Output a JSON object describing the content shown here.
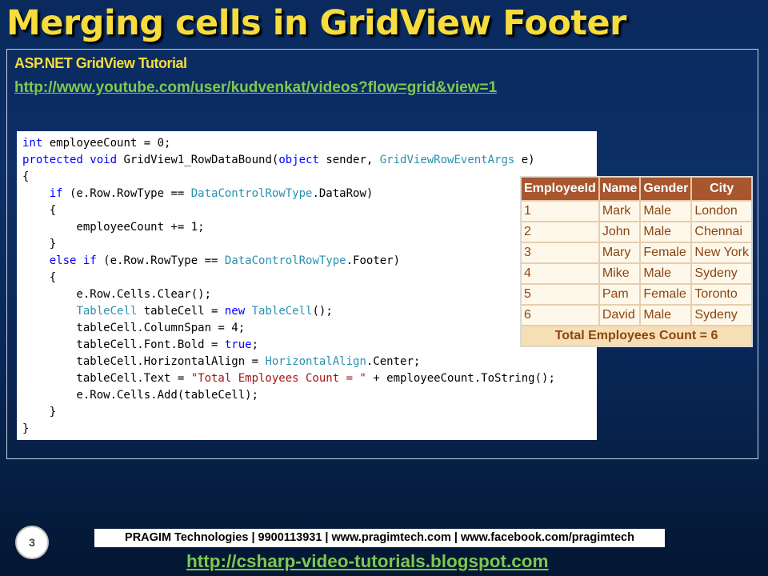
{
  "slide": {
    "title": "Merging cells in GridView Footer",
    "subtitle": "ASP.NET GridView Tutorial",
    "youtube_link": "http://www.youtube.com/user/kudvenkat/videos?flow=grid&view=1",
    "number": "3",
    "footer_text": "PRAGIM Technologies | 9900113931 | www.pragimtech.com | www.facebook.com/pragimtech",
    "blog_link": "http://csharp-video-tutorials.blogspot.com"
  },
  "code": {
    "lines": [
      [
        {
          "t": "int",
          "c": "kw"
        },
        {
          "t": " employeeCount = 0;"
        }
      ],
      [
        {
          "t": "protected",
          "c": "kw"
        },
        {
          "t": " "
        },
        {
          "t": "void",
          "c": "kw"
        },
        {
          "t": " GridView1_RowDataBound("
        },
        {
          "t": "object",
          "c": "kw"
        },
        {
          "t": " sender, "
        },
        {
          "t": "GridViewRowEventArgs",
          "c": "tp"
        },
        {
          "t": " e)"
        }
      ],
      [
        {
          "t": "{"
        }
      ],
      [
        {
          "t": "    "
        },
        {
          "t": "if",
          "c": "kw"
        },
        {
          "t": " (e.Row.RowType == "
        },
        {
          "t": "DataControlRowType",
          "c": "tp"
        },
        {
          "t": ".DataRow)"
        }
      ],
      [
        {
          "t": "    {"
        }
      ],
      [
        {
          "t": "        employeeCount += 1;"
        }
      ],
      [
        {
          "t": "    }"
        }
      ],
      [
        {
          "t": "    "
        },
        {
          "t": "else",
          "c": "kw"
        },
        {
          "t": " "
        },
        {
          "t": "if",
          "c": "kw"
        },
        {
          "t": " (e.Row.RowType == "
        },
        {
          "t": "DataControlRowType",
          "c": "tp"
        },
        {
          "t": ".Footer)"
        }
      ],
      [
        {
          "t": "    {"
        }
      ],
      [
        {
          "t": "        e.Row.Cells.Clear();"
        }
      ],
      [
        {
          "t": "        "
        },
        {
          "t": "TableCell",
          "c": "tp"
        },
        {
          "t": " tableCell = "
        },
        {
          "t": "new",
          "c": "kw"
        },
        {
          "t": " "
        },
        {
          "t": "TableCell",
          "c": "tp"
        },
        {
          "t": "();"
        }
      ],
      [
        {
          "t": "        tableCell.ColumnSpan = 4;"
        }
      ],
      [
        {
          "t": "        tableCell.Font.Bold = "
        },
        {
          "t": "true",
          "c": "kw"
        },
        {
          "t": ";"
        }
      ],
      [
        {
          "t": "        tableCell.HorizontalAlign = "
        },
        {
          "t": "HorizontalAlign",
          "c": "tp"
        },
        {
          "t": ".Center;"
        }
      ],
      [
        {
          "t": "        tableCell.Text = "
        },
        {
          "t": "\"Total Employees Count = \"",
          "c": "str"
        },
        {
          "t": " + employeeCount.ToString();"
        }
      ],
      [
        {
          "t": "        e.Row.Cells.Add(tableCell);"
        }
      ],
      [
        {
          "t": "    }"
        }
      ],
      [
        {
          "t": "}"
        }
      ]
    ]
  },
  "grid": {
    "headers": [
      "EmployeeId",
      "Name",
      "Gender",
      "City"
    ],
    "rows": [
      [
        "1",
        "Mark",
        "Male",
        "London"
      ],
      [
        "2",
        "John",
        "Male",
        "Chennai"
      ],
      [
        "3",
        "Mary",
        "Female",
        "New York"
      ],
      [
        "4",
        "Mike",
        "Male",
        "Sydeny"
      ],
      [
        "5",
        "Pam",
        "Female",
        "Toronto"
      ],
      [
        "6",
        "David",
        "Male",
        "Sydeny"
      ]
    ],
    "footer": "Total Employees Count = 6"
  },
  "colors": {
    "title": "#f6dc3c",
    "link": "#7ec850",
    "grid_header_bg": "#a8562e",
    "grid_cell_text": "#8c4510",
    "grid_footer_bg": "#f7dfb5"
  }
}
